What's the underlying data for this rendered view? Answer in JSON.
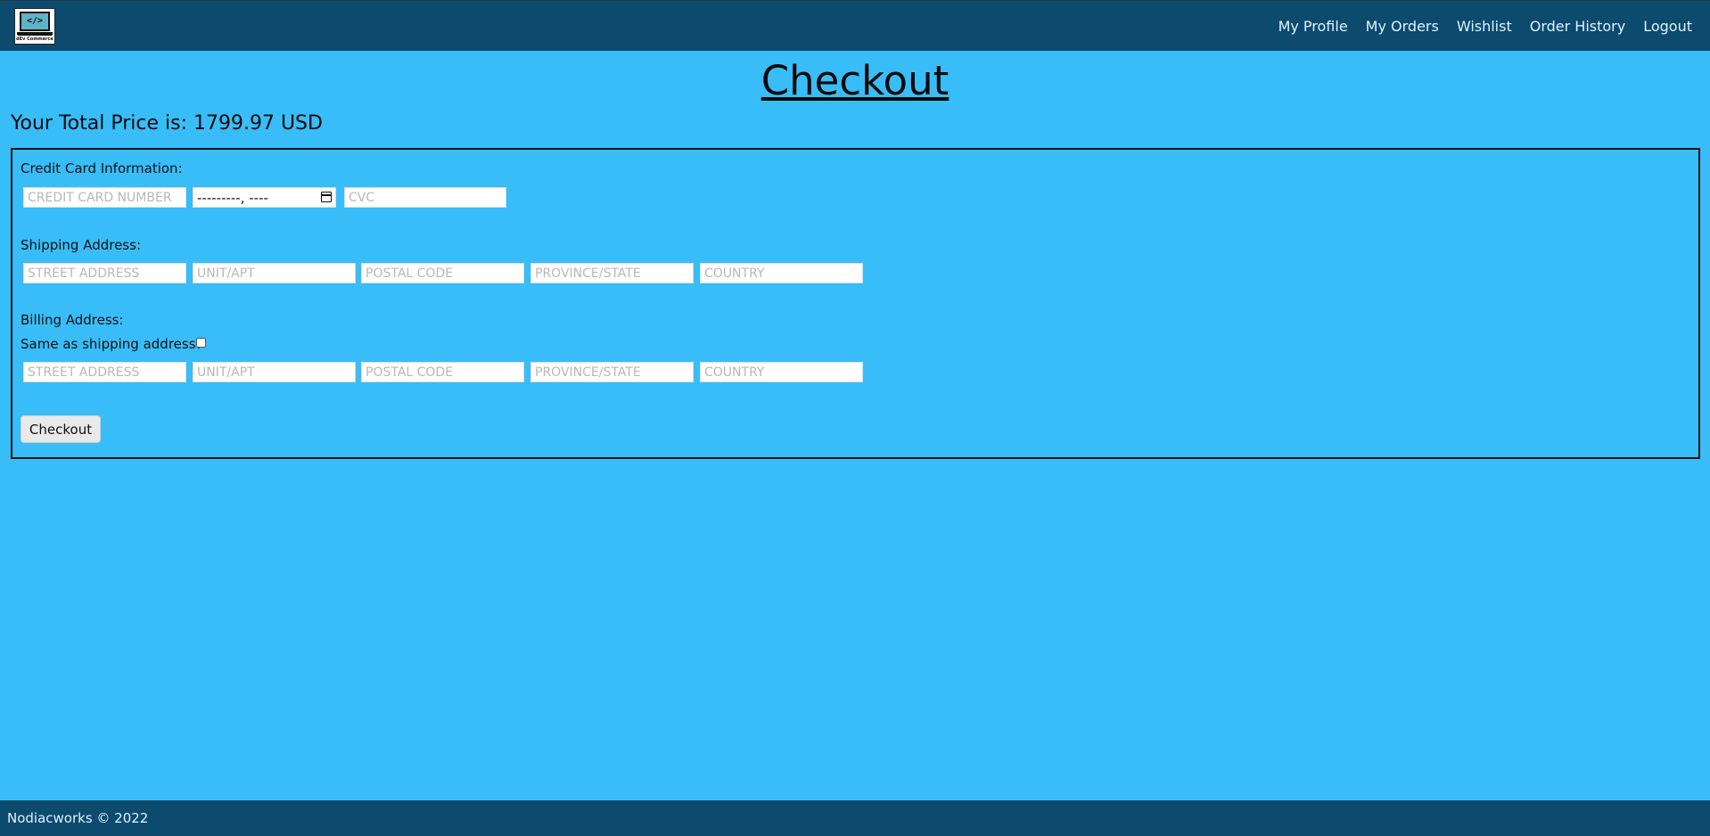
{
  "navbar": {
    "logo_screen": "</>",
    "logo_caption": "dEv Commerce",
    "links": [
      "My Profile",
      "My Orders",
      "Wishlist",
      "Order History",
      "Logout"
    ]
  },
  "page": {
    "title": "Checkout",
    "total_label": "Your Total Price is:",
    "total_value": "1799.97 USD"
  },
  "credit_card": {
    "label": "Credit Card Information:",
    "card_number_placeholder": "CREDIT CARD NUMBER",
    "expiry_value": "---------, ----",
    "cvc_placeholder": "CVC"
  },
  "shipping": {
    "label": "Shipping Address:",
    "street_placeholder": "STREET ADDRESS",
    "unit_placeholder": "UNIT/APT",
    "postal_placeholder": "POSTAL CODE",
    "province_placeholder": "PROVINCE/STATE",
    "country_placeholder": "COUNTRY"
  },
  "billing": {
    "label": "Billing Address:",
    "same_as_shipping_label": "Same as shipping address?",
    "same_as_shipping_checked": false,
    "street_placeholder": "STREET ADDRESS",
    "unit_placeholder": "UNIT/APT",
    "postal_placeholder": "POSTAL CODE",
    "province_placeholder": "PROVINCE/STATE",
    "country_placeholder": "COUNTRY"
  },
  "actions": {
    "checkout_label": "Checkout"
  },
  "footer": {
    "text": "Nodiacworks © 2022"
  },
  "colors": {
    "background": "#38bdf8",
    "navbar": "#0c4a6e"
  }
}
